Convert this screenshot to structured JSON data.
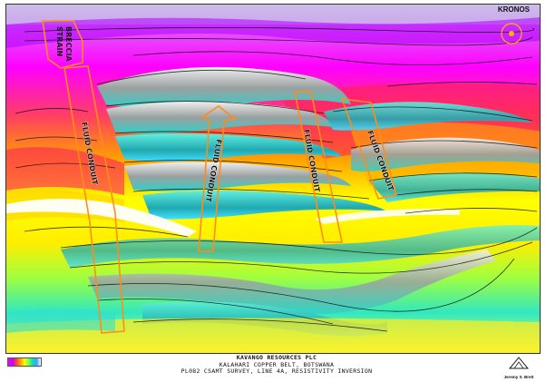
{
  "header": {
    "brand": "KRONOS"
  },
  "annotations": {
    "breccia": "BRECCIA",
    "breccia_prefix": "STRAIN",
    "conduits": [
      {
        "label": "FLUID CONDUIT"
      },
      {
        "label": "FLUID CONDUIT"
      },
      {
        "label": "FLUID CONDUIT"
      },
      {
        "label": "FLUID CONDUIT"
      }
    ],
    "conduit_color": "#ff8c1a"
  },
  "title_block": {
    "company": "KAVANGO RESOURCES PLC",
    "line2": "KALAHARI COPPER BELT, BOTSWANA",
    "line3": "PL082 CSAMT SURVEY, LINE 4A, RESISTIVITY INVERSION"
  },
  "author": {
    "name": "Jeremy S. Brett"
  },
  "palette": {
    "magenta": "#ff00ff",
    "purple": "#c000ff",
    "red": "#ff3040",
    "orange": "#ff9a00",
    "yellow": "#ffff00",
    "green": "#60ff40",
    "cyan": "#20d8c8",
    "white": "#ffffff"
  }
}
